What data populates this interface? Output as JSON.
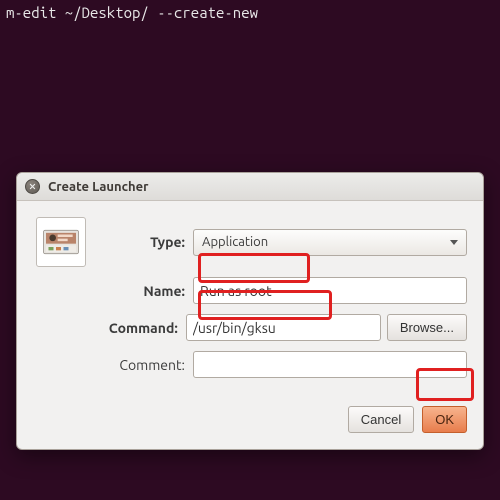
{
  "terminal": {
    "line": "m-edit ~/Desktop/ --create-new"
  },
  "dialog": {
    "title": "Create Launcher",
    "labels": {
      "type": "Type:",
      "name": "Name:",
      "command": "Command:",
      "comment": "Comment:"
    },
    "fields": {
      "type_value": "Application",
      "name_value": "Run as root",
      "command_value": "/usr/bin/gksu",
      "comment_value": ""
    },
    "buttons": {
      "browse": "Browse...",
      "cancel": "Cancel",
      "ok": "OK"
    }
  },
  "icons": {
    "close": "close-icon",
    "launcher": "launcher-panel-icon",
    "dropdown": "chevron-down-icon"
  }
}
